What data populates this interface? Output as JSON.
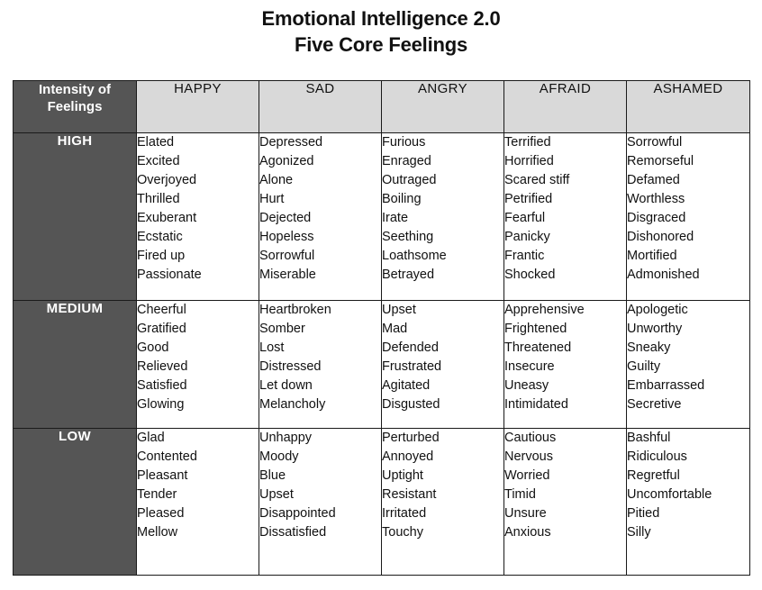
{
  "title": {
    "line1": "Emotional Intelligence 2.0",
    "line2": "Five Core Feelings"
  },
  "colors": {
    "header_dark": "#555555",
    "header_light": "#d9d9d9",
    "border": "#1a1a1a",
    "text": "#111111",
    "header_dark_text": "#ffffff",
    "background": "#ffffff"
  },
  "table": {
    "corner_header": "Intensity of Feelings",
    "columns": [
      "HAPPY",
      "SAD",
      "ANGRY",
      "AFRAID",
      "ASHAMED"
    ],
    "rows": [
      {
        "intensity": "HIGH",
        "cells": [
          [
            "Elated",
            "Excited",
            "Overjoyed",
            "Thrilled",
            "Exuberant",
            "Ecstatic",
            "Fired up",
            "Passionate"
          ],
          [
            "Depressed",
            "Agonized",
            "Alone",
            "Hurt",
            "Dejected",
            "Hopeless",
            "Sorrowful",
            "Miserable"
          ],
          [
            "Furious",
            "Enraged",
            "Outraged",
            "Boiling",
            "Irate",
            "Seething",
            "Loathsome",
            "Betrayed"
          ],
          [
            "Terrified",
            "Horrified",
            "Scared stiff",
            "Petrified",
            "Fearful",
            "Panicky",
            "Frantic",
            "Shocked"
          ],
          [
            "Sorrowful",
            "Remorseful",
            "Defamed",
            "Worthless",
            "Disgraced",
            "Dishonored",
            "Mortified",
            "Admonished"
          ]
        ]
      },
      {
        "intensity": "MEDIUM",
        "cells": [
          [
            "Cheerful",
            "Gratified",
            "Good",
            "Relieved",
            "Satisfied",
            "Glowing"
          ],
          [
            "Heartbroken",
            "Somber",
            "Lost",
            "Distressed",
            "Let down",
            "Melancholy"
          ],
          [
            "Upset",
            "Mad",
            "Defended",
            "Frustrated",
            "Agitated",
            "Disgusted"
          ],
          [
            "Apprehensive",
            "Frightened",
            "Threatened",
            "Insecure",
            "Uneasy",
            "Intimidated"
          ],
          [
            "Apologetic",
            "Unworthy",
            "Sneaky",
            "Guilty",
            "Embarrassed",
            "Secretive"
          ]
        ]
      },
      {
        "intensity": "LOW",
        "cells": [
          [
            "Glad",
            "Contented",
            "Pleasant",
            "Tender",
            "Pleased",
            "Mellow"
          ],
          [
            "Unhappy",
            "Moody",
            "Blue",
            "Upset",
            "Disappointed",
            "Dissatisfied"
          ],
          [
            "Perturbed",
            "Annoyed",
            "Uptight",
            "Resistant",
            "Irritated",
            "Touchy"
          ],
          [
            "Cautious",
            "Nervous",
            "Worried",
            "Timid",
            "Unsure",
            "Anxious"
          ],
          [
            "Bashful",
            "Ridiculous",
            "Regretful",
            "Uncomfortable",
            "Pitied",
            "Silly"
          ]
        ]
      }
    ]
  }
}
